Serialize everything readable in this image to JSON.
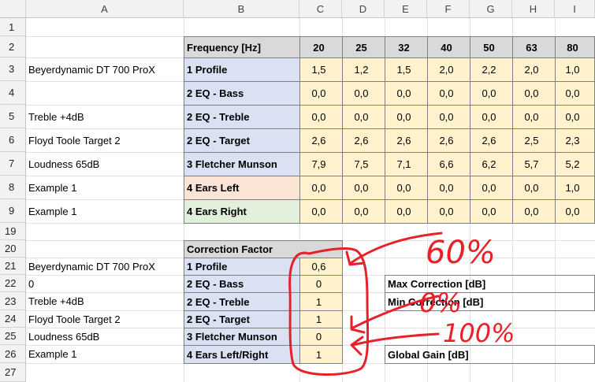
{
  "columns": [
    "A",
    "B",
    "C",
    "D",
    "E",
    "F",
    "G",
    "H",
    "I"
  ],
  "rows": [
    "1",
    "2",
    "3",
    "4",
    "5",
    "6",
    "7",
    "8",
    "9",
    "19",
    "20",
    "21",
    "22",
    "23",
    "24",
    "25",
    "26",
    "27"
  ],
  "labels_a": [
    "Beyerdynamic DT 700 ProX",
    "",
    "Treble +4dB",
    "Floyd Toole Target 2",
    "Loudness 65dB",
    "Example 1",
    "Example 1"
  ],
  "header_freq": "Frequency [Hz]",
  "frequencies": [
    "20",
    "25",
    "32",
    "40",
    "50",
    "63",
    "80"
  ],
  "row_names": [
    "1 Profile",
    "2 EQ - Bass",
    "2 EQ - Treble",
    "2 EQ - Target",
    "3 Fletcher Munson",
    "4 Ears Left",
    "4 Ears Right"
  ],
  "table": [
    [
      "1,5",
      "1,2",
      "1,5",
      "2,0",
      "2,2",
      "2,0",
      "1,0"
    ],
    [
      "0,0",
      "0,0",
      "0,0",
      "0,0",
      "0,0",
      "0,0",
      "0,0"
    ],
    [
      "0,0",
      "0,0",
      "0,0",
      "0,0",
      "0,0",
      "0,0",
      "0,0"
    ],
    [
      "2,6",
      "2,6",
      "2,6",
      "2,6",
      "2,6",
      "2,5",
      "2,3"
    ],
    [
      "7,9",
      "7,5",
      "7,1",
      "6,6",
      "6,2",
      "5,7",
      "5,2"
    ],
    [
      "0,0",
      "0,0",
      "0,0",
      "0,0",
      "0,0",
      "0,0",
      "1,0"
    ],
    [
      "0,0",
      "0,0",
      "0,0",
      "0,0",
      "0,0",
      "0,0",
      "0,0"
    ]
  ],
  "correction": {
    "header": "Correction Factor",
    "labels_a": [
      "Beyerdynamic DT 700 ProX",
      "0",
      "Treble +4dB",
      "Floyd Toole Target 2",
      "Loudness 65dB",
      "Example 1"
    ],
    "names": [
      "1 Profile",
      "2 EQ - Bass",
      "2 EQ - Treble",
      "2 EQ - Target",
      "3 Fletcher Munson",
      "4 Ears Left/Right"
    ],
    "values": [
      "0,6",
      "0",
      "1",
      "1",
      "0",
      "1"
    ]
  },
  "side_labels": {
    "max": "Max Correction [dB]",
    "min": "Min Correction [dB]",
    "gain": "Global Gain [dB]"
  },
  "annotations": [
    "60%",
    "0%",
    "100%"
  ],
  "colors": {
    "profile": "#fff2cc",
    "blue_label": "#d9e1f2",
    "header_gray": "#d9d9d9",
    "ears_left": "#fce4d6",
    "ears_right": "#e2efda",
    "ink": "#e8202a"
  }
}
